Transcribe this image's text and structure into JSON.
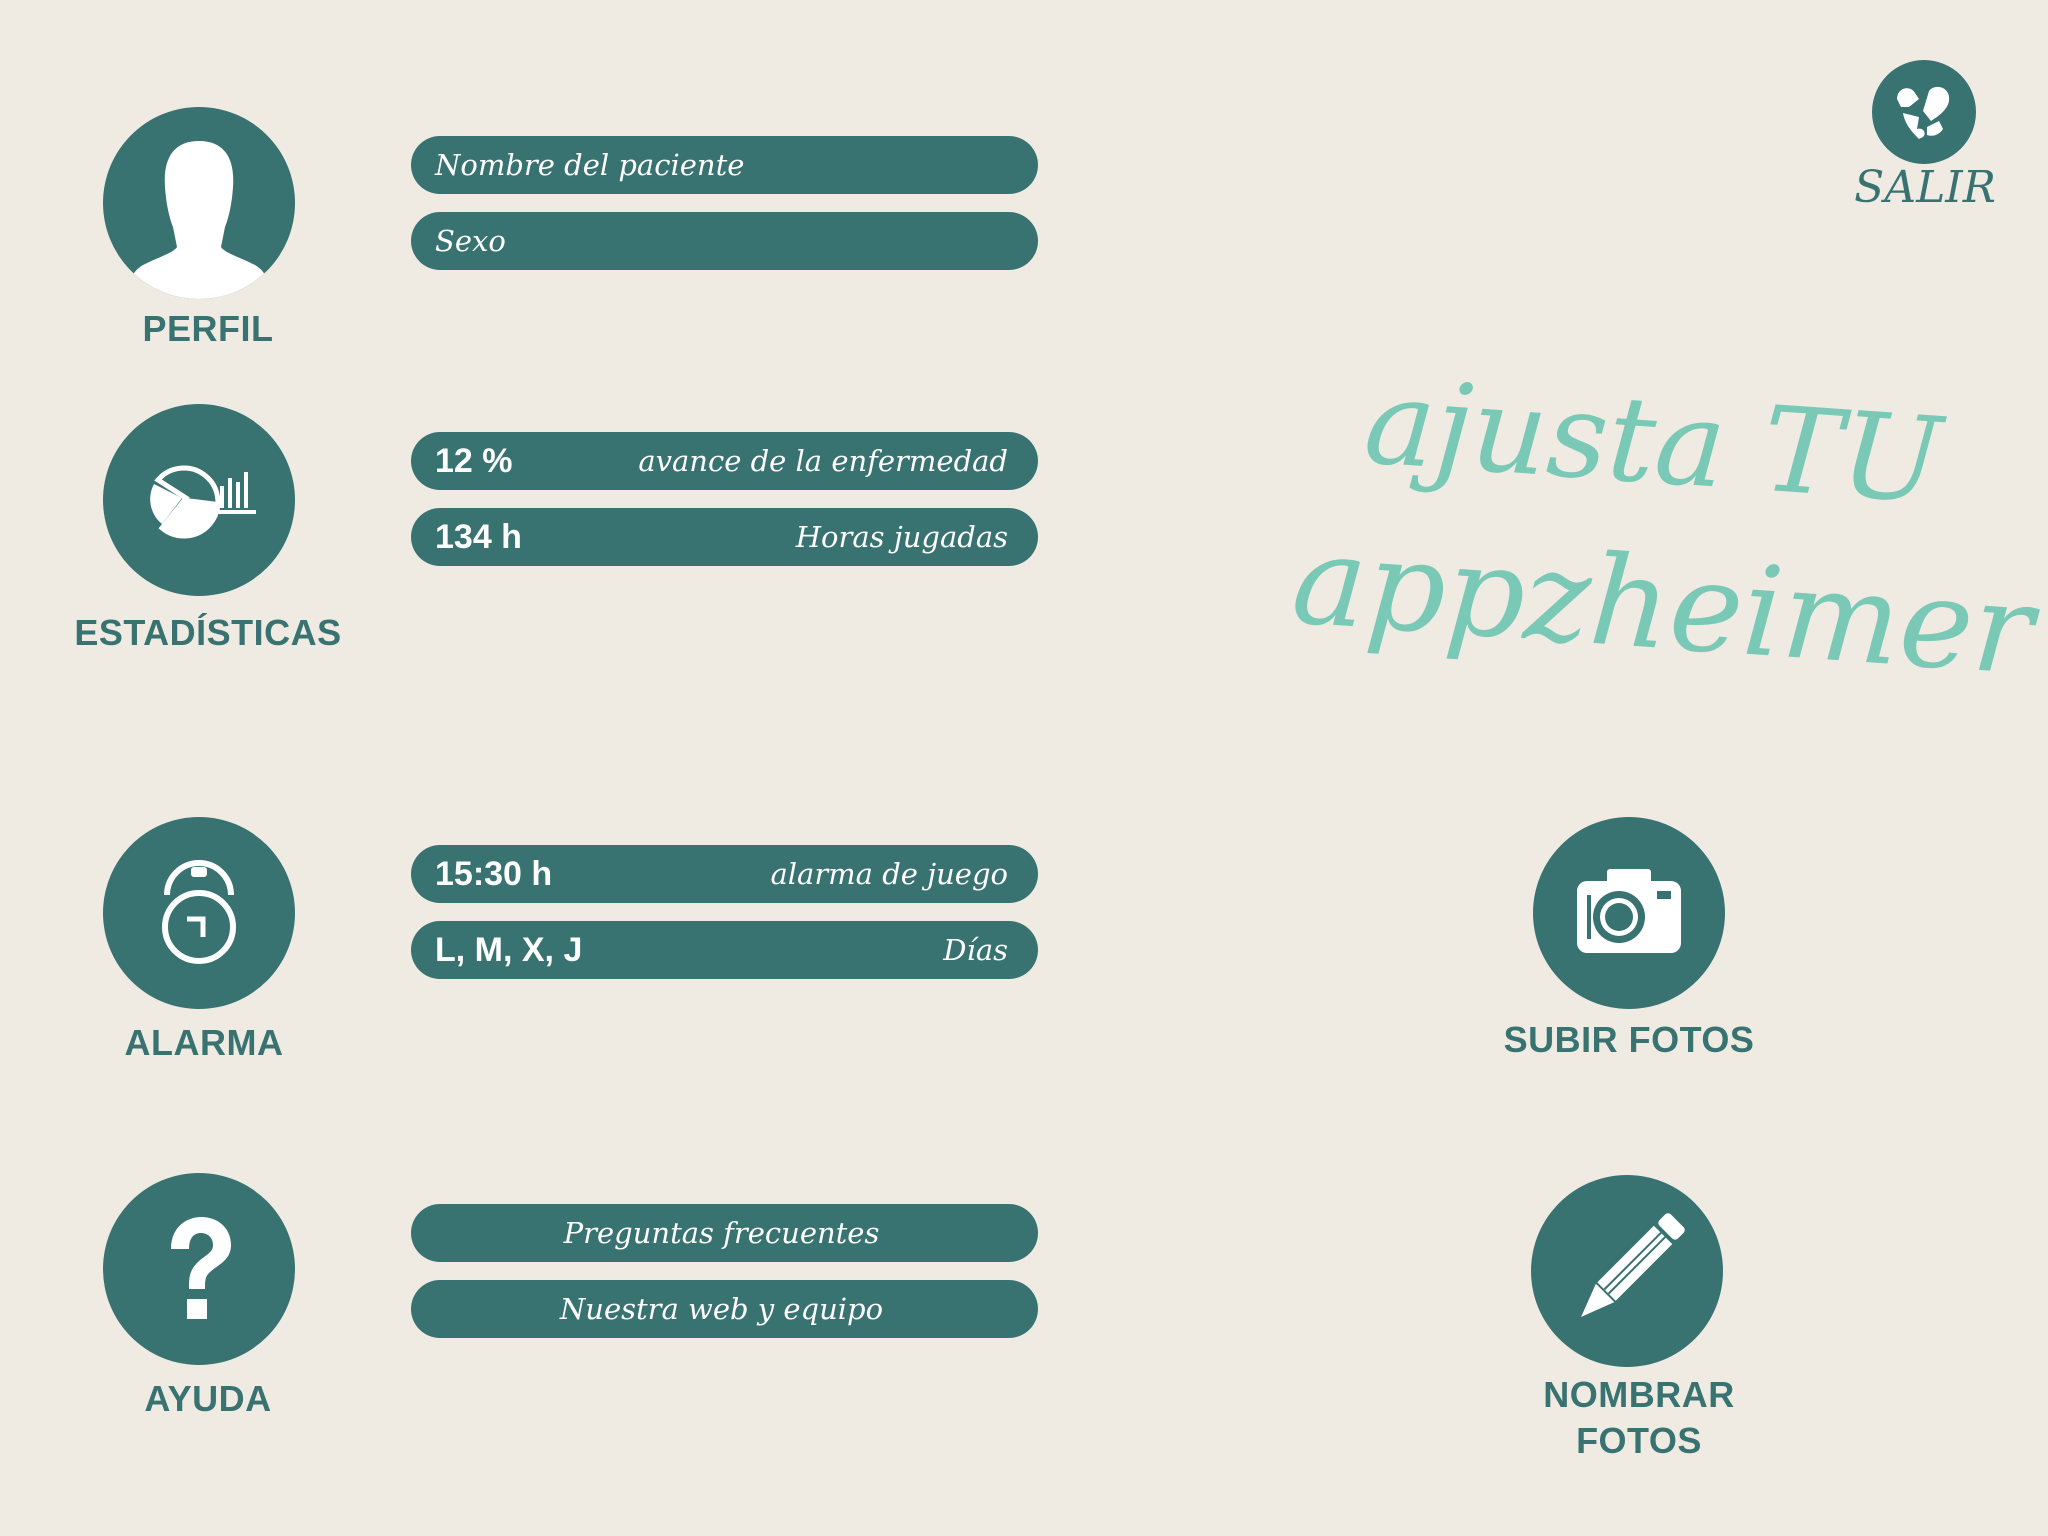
{
  "exit": {
    "label": "SALIR",
    "icon": "puzzle-heart-icon"
  },
  "headline": {
    "line1": "ajusta TU",
    "line2": "appzheimer"
  },
  "profile": {
    "label": "PERFIL",
    "icon": "person-silhouette-icon",
    "fields": [
      "Nombre del paciente",
      "Sexo"
    ]
  },
  "stats": {
    "label": "ESTADÍSTICAS",
    "icon": "pie-chart-icon",
    "rows": [
      {
        "value": "12 %",
        "caption": "avance de la enfermedad"
      },
      {
        "value": "134 h",
        "caption": "Horas jugadas"
      }
    ]
  },
  "alarm": {
    "label": "ALARMA",
    "icon": "alarm-clock-icon",
    "rows": [
      {
        "value": "15:30 h",
        "caption": "alarma de juego"
      },
      {
        "value": "L, M, X, J",
        "caption": "Días"
      }
    ]
  },
  "help": {
    "label": "AYUDA",
    "icon": "question-mark-icon",
    "links": [
      "Preguntas frecuentes",
      "Nuestra web y equipo"
    ]
  },
  "upload": {
    "label": "SUBIR FOTOS",
    "icon": "camera-icon"
  },
  "name_photos": {
    "label_line1": "NOMBRAR",
    "label_line2": "FOTOS",
    "icon": "pencil-icon"
  },
  "colors": {
    "background": "#efebe2",
    "primary": "#387271",
    "accent": "#79c9b6",
    "text_light": "#ffffff"
  }
}
